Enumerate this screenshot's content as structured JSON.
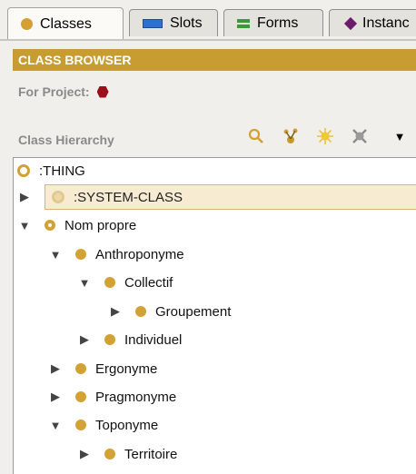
{
  "tabs": [
    {
      "label": "Classes",
      "icon": "class-dot-icon",
      "active": true
    },
    {
      "label": "Slots",
      "icon": "slots-icon",
      "active": false
    },
    {
      "label": "Forms",
      "icon": "forms-icon",
      "active": false
    },
    {
      "label": "Instanc",
      "icon": "instances-diamond-icon",
      "active": false
    }
  ],
  "browser": {
    "title": "CLASS BROWSER",
    "project_label": "For Project:",
    "hierarchy_label": "Class Hierarchy"
  },
  "toolbar": {
    "icons": [
      "view-references-icon",
      "create-subclass-icon",
      "create-class-icon",
      "delete-class-icon",
      "dropdown-menu-icon"
    ],
    "dropdown_glyph": "▼"
  },
  "tree": [
    {
      "label": ":THING",
      "level": 0,
      "expander": "none",
      "bullet": "ring"
    },
    {
      "label": ":SYSTEM-CLASS",
      "level": 1,
      "expander": "collapsed",
      "bullet": "faded",
      "selected": true
    },
    {
      "label": "Nom propre",
      "level": 1,
      "expander": "expanded",
      "bullet": "ring-solid"
    },
    {
      "label": "Anthroponyme",
      "level": 2,
      "expander": "expanded",
      "bullet": "solid"
    },
    {
      "label": "Collectif",
      "level": 3,
      "expander": "expanded",
      "bullet": "solid"
    },
    {
      "label": "Groupement",
      "level": 4,
      "expander": "collapsed",
      "bullet": "solid"
    },
    {
      "label": "Individuel",
      "level": 3,
      "expander": "collapsed",
      "bullet": "solid"
    },
    {
      "label": "Ergonyme",
      "level": 2,
      "expander": "collapsed",
      "bullet": "solid"
    },
    {
      "label": "Pragmonyme",
      "level": 2,
      "expander": "collapsed",
      "bullet": "solid"
    },
    {
      "label": "Toponyme",
      "level": 2,
      "expander": "expanded",
      "bullet": "solid"
    },
    {
      "label": "Territoire",
      "level": 3,
      "expander": "collapsed",
      "bullet": "solid"
    }
  ],
  "colors": {
    "accent": "#c79d32",
    "class_bullet": "#d2a234",
    "project_icon": "#9b0e1c",
    "selection": "#f7ecd2"
  }
}
